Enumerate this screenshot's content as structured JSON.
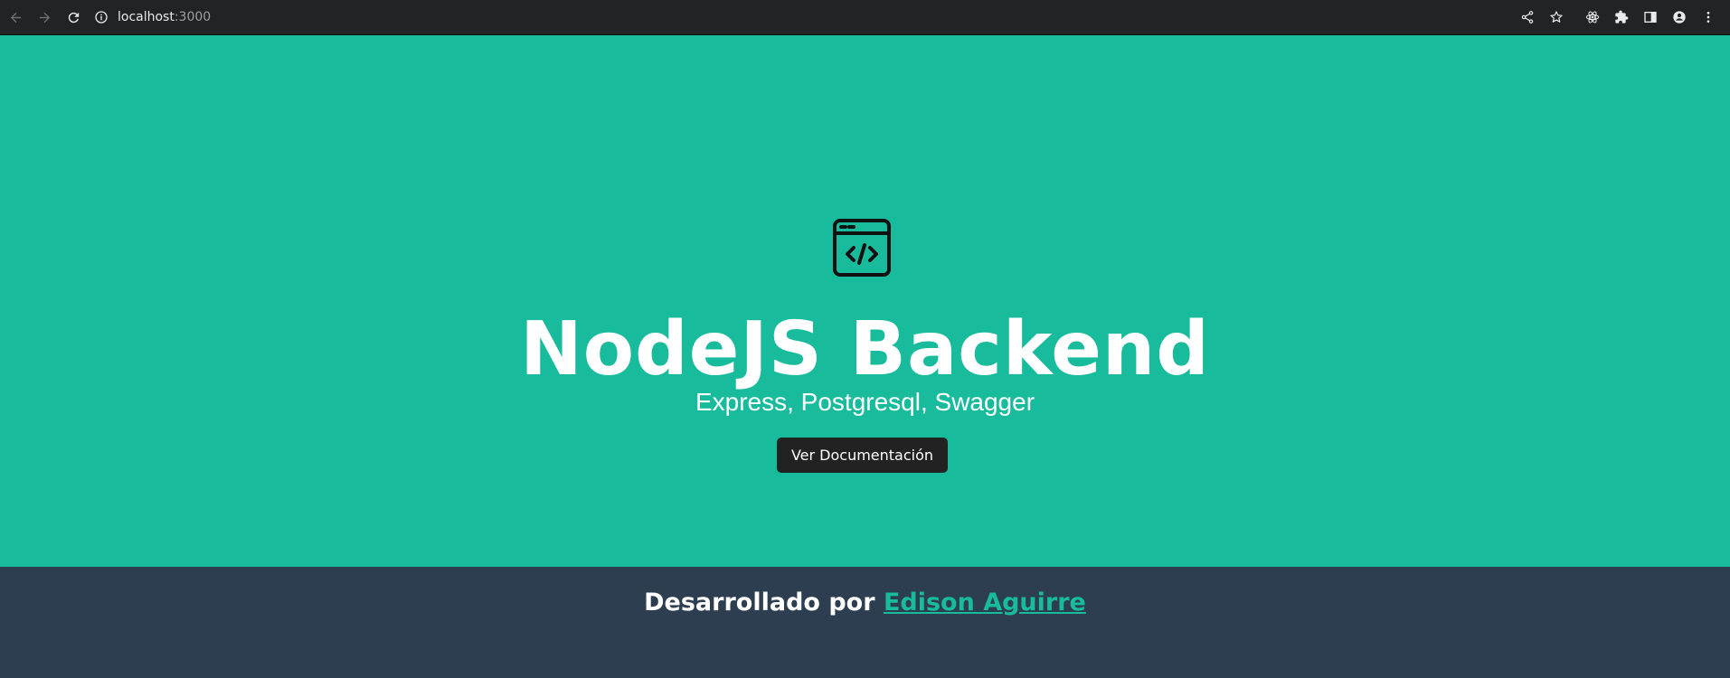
{
  "browser": {
    "url_host": "localhost",
    "url_port": ":3000",
    "icons": [
      "back-icon",
      "forward-icon",
      "reload-icon",
      "info-icon",
      "share-icon",
      "star-icon",
      "react-devtools-icon",
      "extensions-icon",
      "sidepanel-icon",
      "profile-icon",
      "menu-icon"
    ]
  },
  "hero": {
    "icon": "code-window-icon",
    "title": "NodeJS Backend",
    "subtitle": "Express, Postgresql, Swagger",
    "button_label": "Ver Documentación"
  },
  "footer": {
    "prefix": "Desarrollado por ",
    "author": "Edison Aguirre"
  },
  "colors": {
    "hero_bg": "#18bc9c",
    "footer_bg": "#2c3e50",
    "button_bg": "#222222",
    "link": "#18bc9c"
  }
}
